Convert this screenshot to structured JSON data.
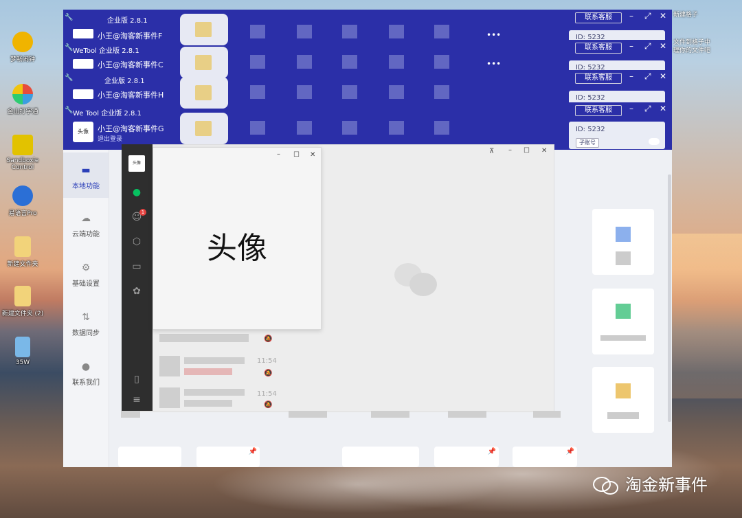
{
  "desktop": {
    "icons": [
      {
        "label": "梦畅闹钟",
        "name": "alarm-clock-icon",
        "color": "#f0b400"
      },
      {
        "label": "金山打字通",
        "name": "typing-tutor-icon",
        "color": "#3c9de0"
      },
      {
        "label": "Sandboxie Control",
        "name": "sandboxie-icon",
        "color": "#e2c200"
      },
      {
        "label": "易语言Pro",
        "name": "eyuyan-pro-icon",
        "color": "#2b6fd6"
      },
      {
        "label": "新建文件夹",
        "name": "folder-icon",
        "color": "#f2d37a"
      },
      {
        "label": "新建文件夹 (2)",
        "name": "folder-icon",
        "color": "#f2d37a"
      },
      {
        "label": "35W",
        "name": "file-icon",
        "color": "#7ab8e8"
      }
    ],
    "top_right_text": [
      "新建格子",
      "文件到格子中",
      "理你的文件吧"
    ]
  },
  "windows": [
    {
      "title": "企业版 2.8.1",
      "account": "小王@淘客新事件F",
      "service_label": "联系客服",
      "id_text": "ID: 5232"
    },
    {
      "title": "WeTool 企业版 2.8.1",
      "account": "小王@淘客新事件C",
      "service_label": "联系客服",
      "id_text": "ID: 5232"
    },
    {
      "title": "企业版 2.8.1",
      "account": "小王@淘客新事件H",
      "service_label": "联系客服",
      "id_text": "ID: 5232"
    },
    {
      "title": "We Tool 企业版 2.8.1",
      "account": "小王@淘客新事件G",
      "service_label": "联系客服",
      "id_text": "ID: 5232",
      "logout": "退出登录",
      "avatar_text": "头像",
      "sub_account": "子账号"
    }
  ],
  "nav": {
    "items": [
      {
        "label": "本地功能",
        "icon": "monitor-icon"
      },
      {
        "label": "云端功能",
        "icon": "cloud-icon"
      },
      {
        "label": "基础设置",
        "icon": "gear-icon"
      },
      {
        "label": "数据同步",
        "icon": "sync-icon"
      },
      {
        "label": "联系我们",
        "icon": "user-icon"
      }
    ]
  },
  "wechat": {
    "avatar_text": "头像",
    "unread_badge": "1",
    "chat_times": [
      "11:54",
      "11:54"
    ]
  },
  "avatar_popup": {
    "text": "头像"
  },
  "watermark": {
    "text": "淘金新事件"
  }
}
